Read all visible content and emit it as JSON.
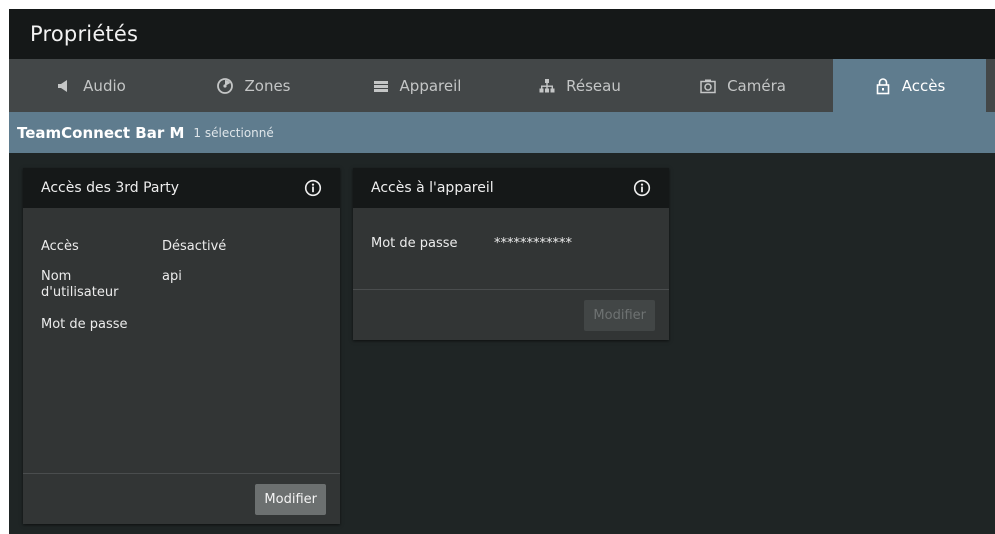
{
  "window": {
    "title": "Propriétés"
  },
  "tabs": [
    {
      "label": "Audio",
      "icon": "speaker-icon",
      "active": false
    },
    {
      "label": "Zones",
      "icon": "zones-icon",
      "active": false
    },
    {
      "label": "Appareil",
      "icon": "device-icon",
      "active": false
    },
    {
      "label": "Réseau",
      "icon": "network-icon",
      "active": false
    },
    {
      "label": "Caméra",
      "icon": "camera-icon",
      "active": false
    },
    {
      "label": "Accès",
      "icon": "lock-icon",
      "active": true
    }
  ],
  "device": {
    "name": "TeamConnect Bar M",
    "selection": "1 sélectionné"
  },
  "cards": {
    "third_party": {
      "title": "Accès des 3rd Party",
      "rows": [
        {
          "label": "Accès",
          "value": "Désactivé"
        },
        {
          "label": "Nom d'utilisateur",
          "value": "api"
        },
        {
          "label": "Mot de passe",
          "value": ""
        }
      ],
      "button_label": "Modifier",
      "button_enabled": true
    },
    "device_access": {
      "title": "Accès à l'appareil",
      "rows": [
        {
          "label": "Mot de passe",
          "value": "************"
        }
      ],
      "button_label": "Modifier",
      "button_enabled": false
    }
  },
  "colors": {
    "background": "#1f2525",
    "title_bar": "#151818",
    "tab_bar": "#434748",
    "accent": "#5f7c8e",
    "card": "#323535"
  }
}
